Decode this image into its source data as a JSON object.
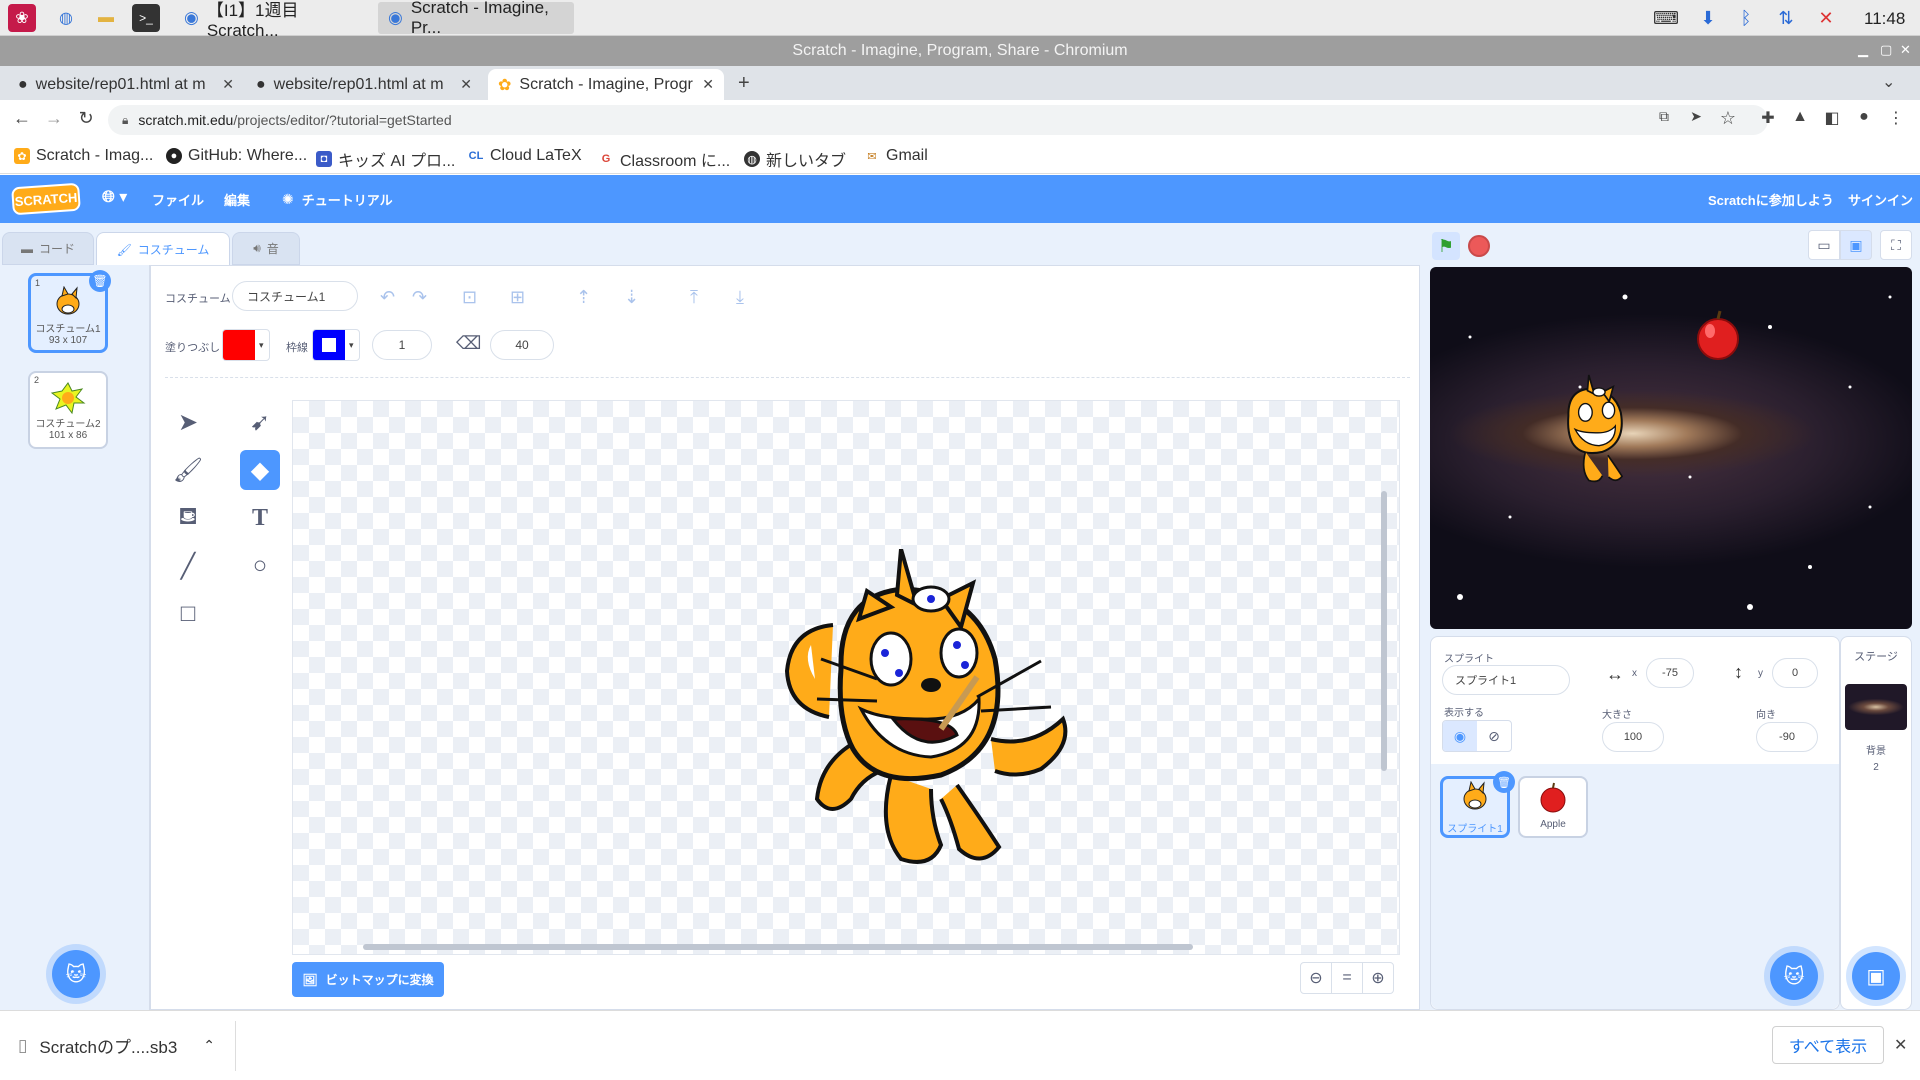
{
  "taskbar": {
    "tasks": [
      {
        "label": "【I1】1週目 Scratch..."
      },
      {
        "label": "Scratch - Imagine, Pr..."
      }
    ],
    "clock": "11:48"
  },
  "window": {
    "title": "Scratch - Imagine, Program, Share - Chromium"
  },
  "tabs": [
    {
      "label": "website/rep01.html at m"
    },
    {
      "label": "website/rep01.html at m"
    },
    {
      "label": "Scratch - Imagine, Progr"
    }
  ],
  "omnibox": {
    "url_host": "scratch.mit.edu",
    "url_path": "/projects/editor/?tutorial=getStarted"
  },
  "bookmarks": [
    {
      "label": "Scratch - Imag..."
    },
    {
      "label": "GitHub: Where..."
    },
    {
      "label": "キッズ AI プロ..."
    },
    {
      "label": "Cloud LaTeX"
    },
    {
      "label": "Classroom に..."
    },
    {
      "label": "新しいタブ"
    },
    {
      "label": "Gmail"
    }
  ],
  "menubar": {
    "logo": "SCRATCH",
    "file": "ファイル",
    "edit": "編集",
    "tutorial": "チュートリアル",
    "join": "Scratchに参加しよう",
    "signin": "サインイン"
  },
  "editor_tabs": {
    "code": "コード",
    "costume": "コスチューム",
    "sound": "音"
  },
  "costumes": [
    {
      "num": "1",
      "name": "コスチューム1",
      "size": "93 x 107"
    },
    {
      "num": "2",
      "name": "コスチューム2",
      "size": "101 x 86"
    }
  ],
  "paint": {
    "costume_label": "コスチューム",
    "costume_name": "コスチューム1",
    "fill_label": "塗りつぶし",
    "stroke_label": "枠線",
    "stroke_width": "1",
    "eraser_size": "40",
    "fill_color": "#ff0000",
    "stroke_color": "#0000ff",
    "convert_button": "ビットマップに変換",
    "zoom_reset": "="
  },
  "sprite_info": {
    "sprite_label": "スプライト",
    "sprite_name": "スプライト1",
    "x_label": "x",
    "x_value": "-75",
    "y_label": "y",
    "y_value": "0",
    "show_label": "表示する",
    "size_label": "大きさ",
    "size_value": "100",
    "direction_label": "向き",
    "direction_value": "-90"
  },
  "sprites": [
    {
      "name": "スプライト1"
    },
    {
      "name": "Apple"
    }
  ],
  "stage_panel": {
    "title": "ステージ",
    "backdrop_label": "背景",
    "backdrop_count": "2"
  },
  "downloads": {
    "file": "Scratchのプ....sb3",
    "show_all": "すべて表示"
  },
  "colors": {
    "scratch_blue": "#4d97ff",
    "cat_orange": "#ffab19"
  }
}
